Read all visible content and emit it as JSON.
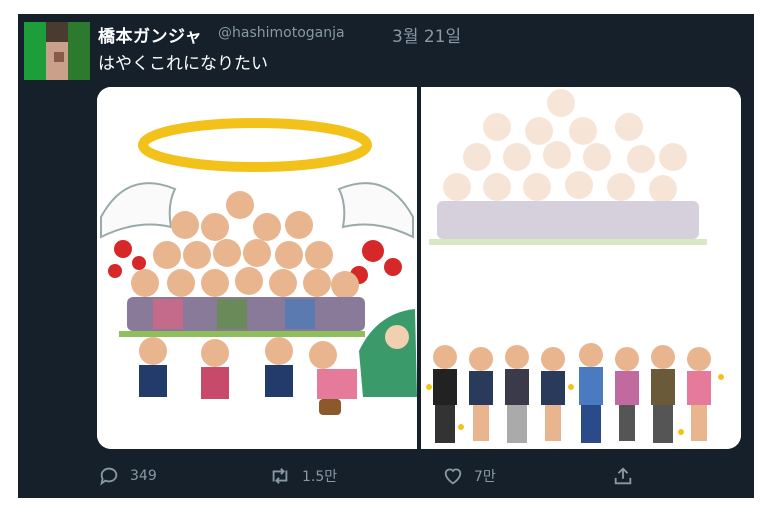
{
  "tweet": {
    "display_name": "橋本ガンジャ",
    "handle": "@hashimotoganja",
    "date": "3월 21일",
    "text": "はやくこれになりたい"
  },
  "media": {
    "left_image": "illustration-elderly-crowd-with-halo-and-virus",
    "right_image": "illustration-faded-elderly-and-cheering-youth"
  },
  "actions": {
    "reply_count": "349",
    "retweet_count": "1.5만",
    "like_count": "7만"
  },
  "icons": {
    "reply": "reply-icon",
    "retweet": "retweet-icon",
    "like": "heart-icon",
    "share": "share-icon"
  },
  "colors": {
    "background": "#15202b",
    "text": "#ffffff",
    "muted": "#8899a6",
    "halo": "#f2c21b",
    "virus": "#d62828"
  }
}
